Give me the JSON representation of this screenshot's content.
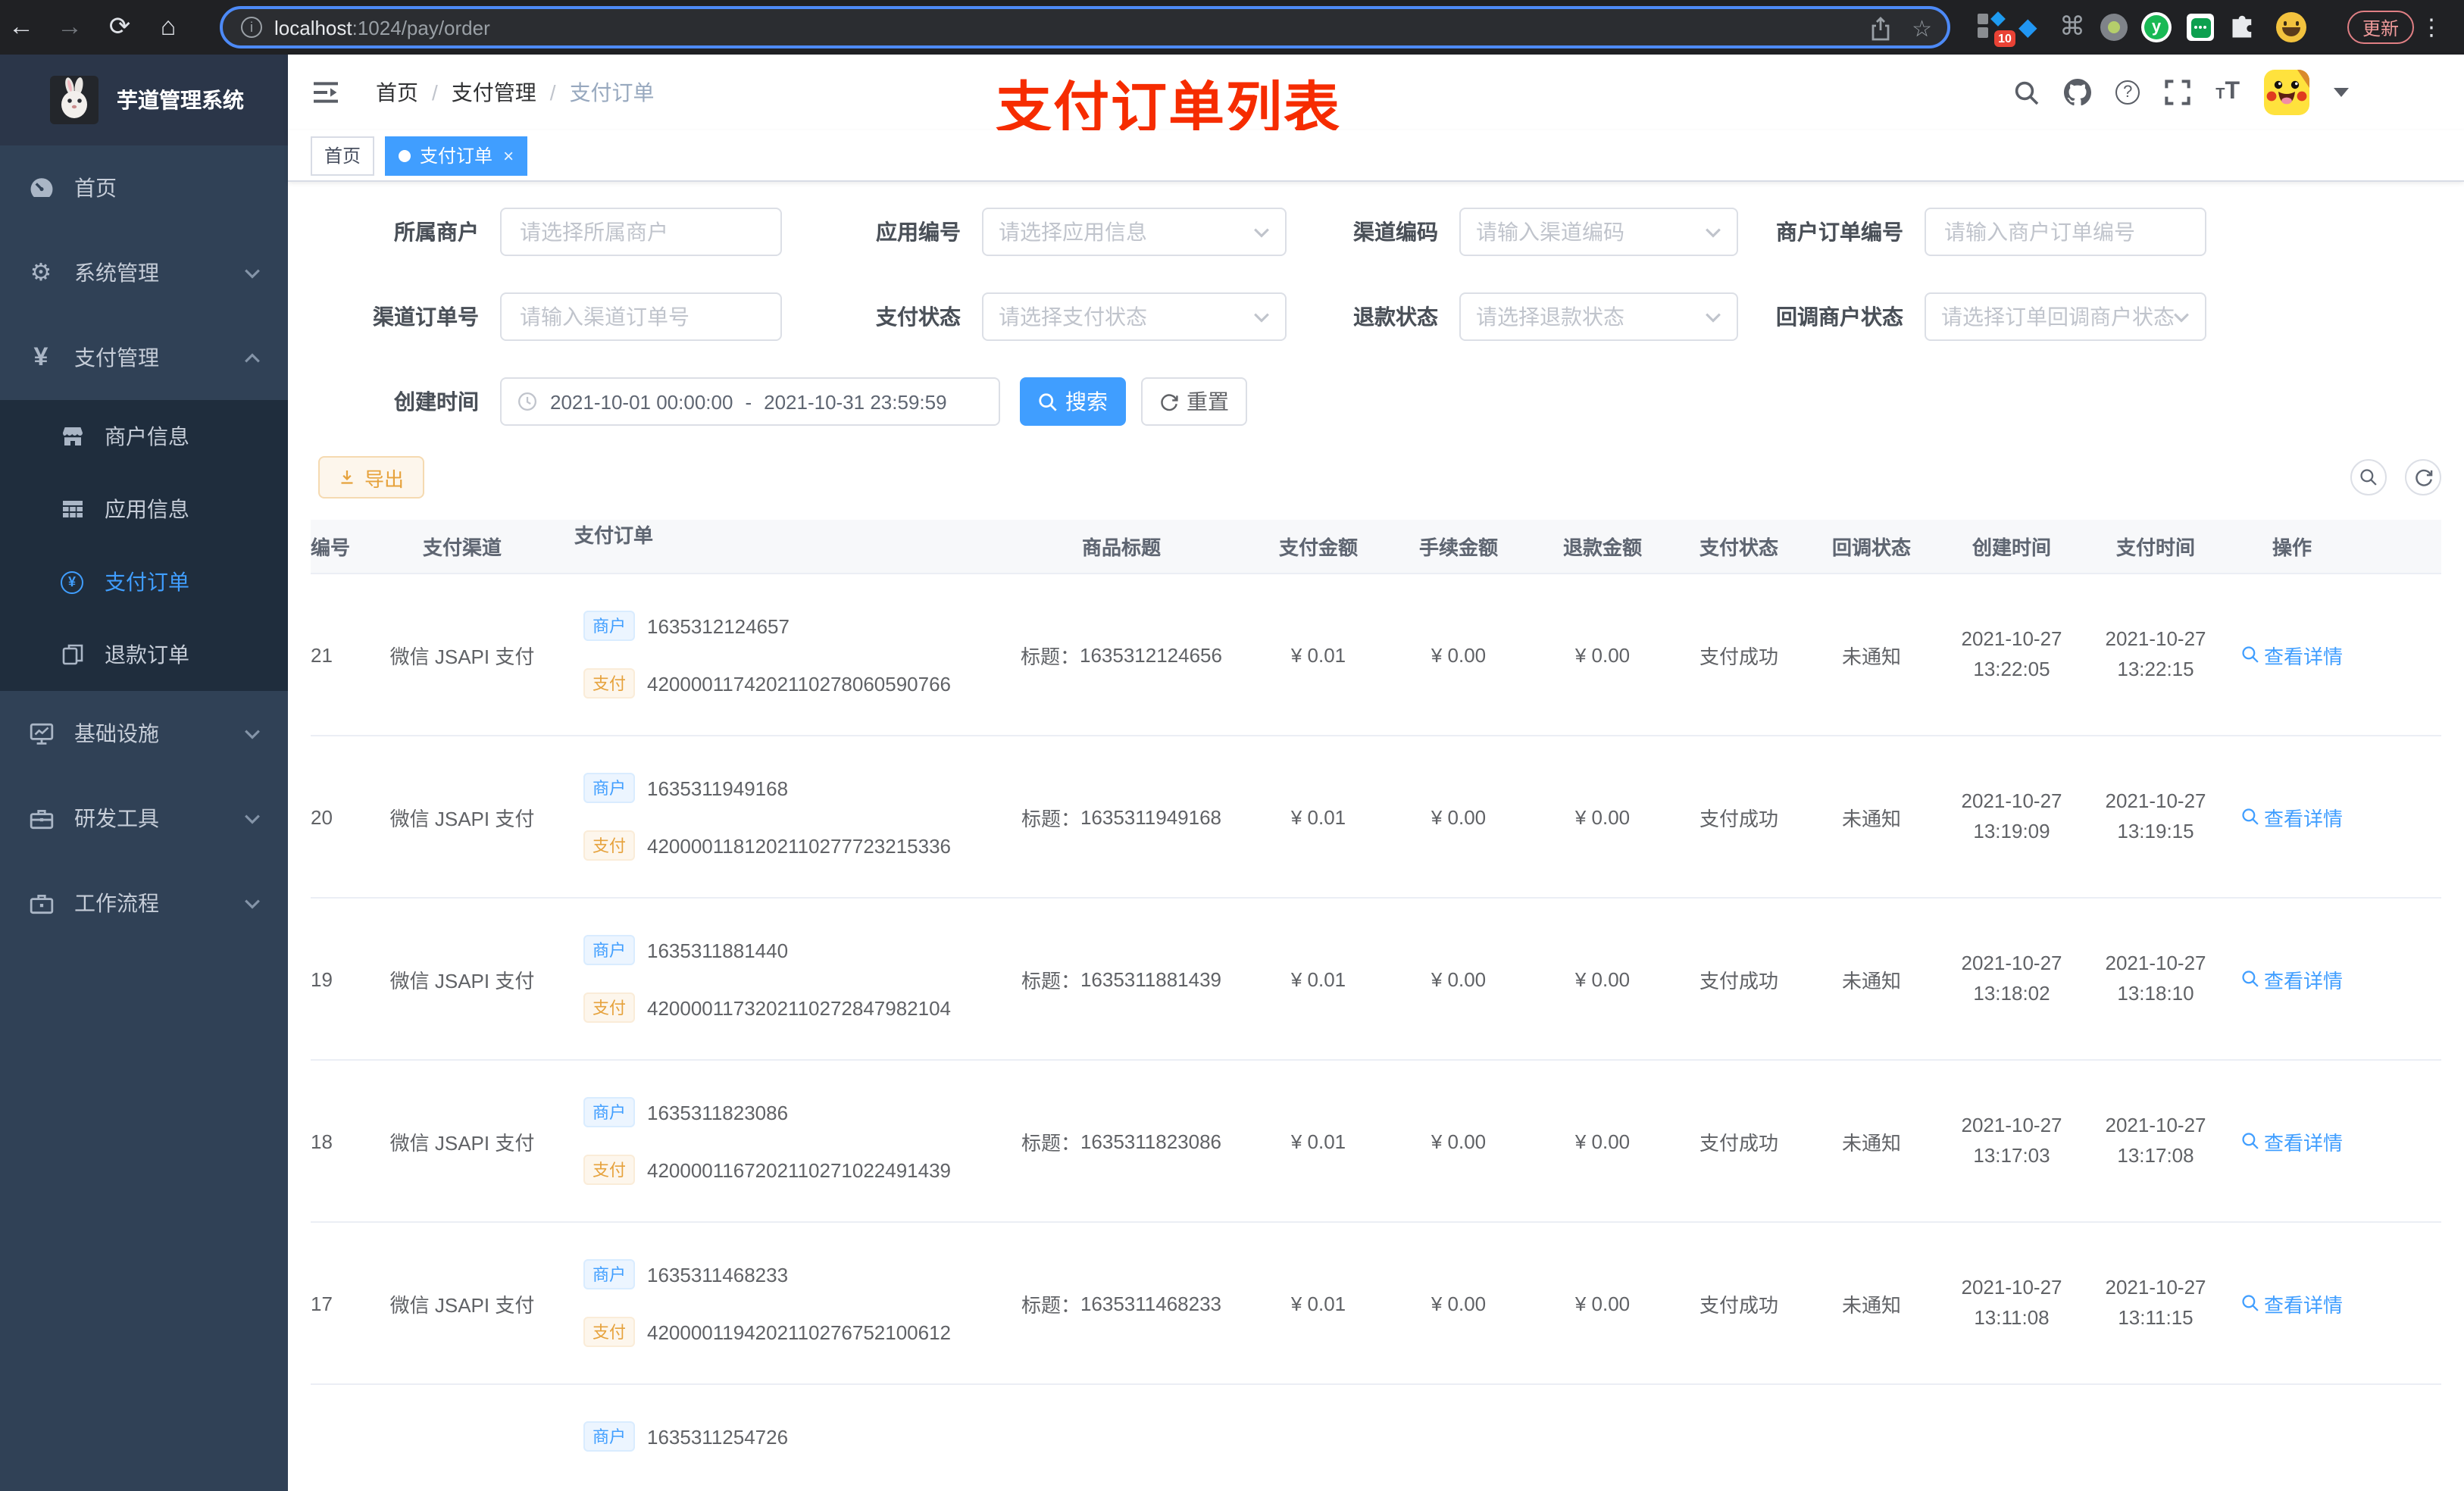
{
  "icons": {
    "back": "←",
    "forward": "→",
    "reload": "⟳",
    "home": "⌂",
    "info": "i",
    "star": "☆",
    "command": "⌘",
    "kite": "◆",
    "kebab": "⋮",
    "gear": "⚙",
    "yen": "¥",
    "close": "×",
    "y_letter": "y"
  },
  "colors": {
    "accent": "#409eff",
    "annotation_red": "#f62c00",
    "warning": "#e6a23c"
  },
  "browser": {
    "url_host": "localhost",
    "url_rest": ":1024/pay/order",
    "extension_badge": "10",
    "update_label": "更新"
  },
  "sidebar": {
    "app_title": "芋道管理系统",
    "menu": [
      {
        "label": "首页"
      },
      {
        "label": "系统管理"
      },
      {
        "label": "支付管理"
      },
      {
        "label": "基础设施"
      },
      {
        "label": "研发工具"
      },
      {
        "label": "工作流程"
      }
    ],
    "submenu": [
      {
        "label": "商户信息"
      },
      {
        "label": "应用信息"
      },
      {
        "label": "支付订单"
      },
      {
        "label": "退款订单"
      }
    ]
  },
  "navbar": {
    "breadcrumb": [
      "首页",
      "支付管理",
      "支付订单"
    ],
    "separator": "/",
    "annotation": "支付订单列表"
  },
  "tags": {
    "home": "首页",
    "active": "支付订单"
  },
  "filters": {
    "merchant_label": "所属商户",
    "merchant_placeholder": "请选择所属商户",
    "app_label": "应用编号",
    "app_placeholder": "请选择应用信息",
    "channel_code_label": "渠道编码",
    "channel_code_placeholder": "请输入渠道编码",
    "merchant_order_label": "商户订单编号",
    "merchant_order_placeholder": "请输入商户订单编号",
    "channel_order_label": "渠道订单号",
    "channel_order_placeholder": "请输入渠道订单号",
    "pay_status_label": "支付状态",
    "pay_status_placeholder": "请选择支付状态",
    "refund_status_label": "退款状态",
    "refund_status_placeholder": "请选择退款状态",
    "notify_status_label": "回调商户状态",
    "notify_status_placeholder": "请选择订单回调商户状态",
    "create_time_label": "创建时间",
    "date_start": "2021-10-01 00:00:00",
    "date_separator": "-",
    "date_end": "2021-10-31 23:59:59",
    "search_label": "搜索",
    "reset_label": "重置"
  },
  "toolbar": {
    "export_label": "导出"
  },
  "table": {
    "columns": [
      "编号",
      "支付渠道",
      "支付订单",
      "商品标题",
      "支付金额",
      "手续金额",
      "退款金额",
      "支付状态",
      "回调状态",
      "创建时间",
      "支付时间",
      "操作"
    ],
    "merchant_tag": "商户",
    "pay_tag": "支付",
    "title_prefix": "标题：",
    "action_label": "查看详情",
    "rows": [
      {
        "id": "21",
        "channel": "微信 JSAPI 支付",
        "merchant_no": "1635312124657",
        "pay_no": "4200001174202110278060590766",
        "title": "1635312124656",
        "amount": "¥ 0.01",
        "fee": "¥ 0.00",
        "refund": "¥ 0.00",
        "status": "支付成功",
        "notify": "未通知",
        "created_date": "2021-10-27",
        "created_time": "13:22:05",
        "paid_date": "2021-10-27",
        "paid_time": "13:22:15"
      },
      {
        "id": "20",
        "channel": "微信 JSAPI 支付",
        "merchant_no": "1635311949168",
        "pay_no": "4200001181202110277723215336",
        "title": "1635311949168",
        "amount": "¥ 0.01",
        "fee": "¥ 0.00",
        "refund": "¥ 0.00",
        "status": "支付成功",
        "notify": "未通知",
        "created_date": "2021-10-27",
        "created_time": "13:19:09",
        "paid_date": "2021-10-27",
        "paid_time": "13:19:15"
      },
      {
        "id": "19",
        "channel": "微信 JSAPI 支付",
        "merchant_no": "1635311881440",
        "pay_no": "4200001173202110272847982104",
        "title": "1635311881439",
        "amount": "¥ 0.01",
        "fee": "¥ 0.00",
        "refund": "¥ 0.00",
        "status": "支付成功",
        "notify": "未通知",
        "created_date": "2021-10-27",
        "created_time": "13:18:02",
        "paid_date": "2021-10-27",
        "paid_time": "13:18:10"
      },
      {
        "id": "18",
        "channel": "微信 JSAPI 支付",
        "merchant_no": "1635311823086",
        "pay_no": "4200001167202110271022491439",
        "title": "1635311823086",
        "amount": "¥ 0.01",
        "fee": "¥ 0.00",
        "refund": "¥ 0.00",
        "status": "支付成功",
        "notify": "未通知",
        "created_date": "2021-10-27",
        "created_time": "13:17:03",
        "paid_date": "2021-10-27",
        "paid_time": "13:17:08"
      },
      {
        "id": "17",
        "channel": "微信 JSAPI 支付",
        "merchant_no": "1635311468233",
        "pay_no": "4200001194202110276752100612",
        "title": "1635311468233",
        "amount": "¥ 0.01",
        "fee": "¥ 0.00",
        "refund": "¥ 0.00",
        "status": "支付成功",
        "notify": "未通知",
        "created_date": "2021-10-27",
        "created_time": "13:11:08",
        "paid_date": "2021-10-27",
        "paid_time": "13:11:15"
      }
    ],
    "partial_row": {
      "merchant_no": "1635311254726"
    }
  }
}
